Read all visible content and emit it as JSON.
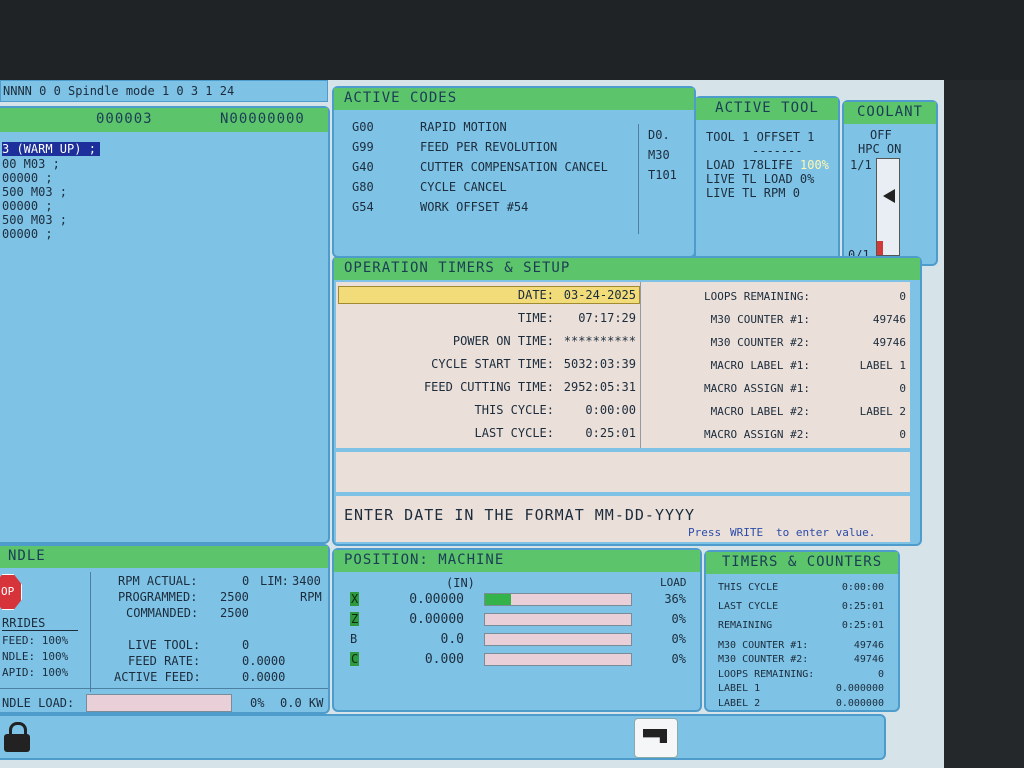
{
  "topbar": {
    "text": "NNNN   0   0 Spindle mode 1 0  3  1  24"
  },
  "program": {
    "header_left": "000003",
    "header_right": "N00000000",
    "lines": [
      "3 (WARM UP) ;",
      "00 M03 ;",
      "00000 ;",
      "500 M03 ;",
      "00000 ;",
      "500 M03 ;",
      "00000 ;"
    ]
  },
  "active_codes": {
    "title": "ACTIVE CODES",
    "codes": [
      {
        "code": "G00",
        "desc": "RAPID MOTION"
      },
      {
        "code": "G99",
        "desc": "FEED PER REVOLUTION"
      },
      {
        "code": "G40",
        "desc": "CUTTER COMPENSATION CANCEL"
      },
      {
        "code": "G80",
        "desc": "CYCLE CANCEL"
      },
      {
        "code": "G54",
        "desc": "WORK OFFSET  #54"
      }
    ],
    "right_codes": [
      "D0.",
      "M30",
      "T101"
    ]
  },
  "active_tool": {
    "title": "ACTIVE TOOL",
    "tool_line": "TOOL 1   OFFSET 1",
    "dash": "-------",
    "load": "LOAD 178LIFE",
    "life_pct": "100%",
    "live_load": "LIVE TL LOAD    0%",
    "live_rpm": "LIVE TL RPM     0"
  },
  "coolant": {
    "title": "COOLANT",
    "off": "OFF",
    "hpc": "HPC ON",
    "top": "1/1",
    "bottom": "0/1",
    "level": 0.15
  },
  "op_timers": {
    "title": "OPERATION TIMERS & SETUP",
    "left": [
      {
        "label": "DATE:",
        "value": "03-24-2025"
      },
      {
        "label": "TIME:",
        "value": "07:17:29"
      },
      {
        "label": "POWER ON TIME:",
        "value": "**********"
      },
      {
        "label": "CYCLE START TIME:",
        "value": "5032:03:39"
      },
      {
        "label": "FEED CUTTING TIME:",
        "value": "2952:05:31"
      },
      {
        "label": "THIS CYCLE:",
        "value": "0:00:00"
      },
      {
        "label": "LAST CYCLE:",
        "value": "0:25:01"
      }
    ],
    "right": [
      {
        "label": "LOOPS REMAINING:",
        "value": "0"
      },
      {
        "label": "M30 COUNTER #1:",
        "value": "49746"
      },
      {
        "label": "M30 COUNTER #2:",
        "value": "49746"
      },
      {
        "label": "MACRO LABEL #1:",
        "value": "LABEL 1"
      },
      {
        "label": "MACRO ASSIGN #1:",
        "value": "0"
      },
      {
        "label": "MACRO LABEL #2:",
        "value": "LABEL 2"
      },
      {
        "label": "MACRO ASSIGN #2:",
        "value": "0"
      }
    ],
    "prompt": "ENTER DATE IN THE FORMAT MM-DD-YYYY",
    "hint_press": "Press",
    "hint_write": "WRITE",
    "hint_rest": "to enter value."
  },
  "spindle": {
    "title": "NDLE",
    "stop": "OP",
    "overrides_title": "RRIDES",
    "overrides": [
      "FEED: 100%",
      "NDLE: 100%",
      "APID: 100%"
    ],
    "rpm_actual_label": "RPM ACTUAL:",
    "rpm_actual": "0",
    "lim_label": "LIM:",
    "lim": "3400",
    "programmed_label": "PROGRAMMED:",
    "programmed": "2500",
    "rpm_unit": "RPM",
    "commanded_label": "COMMANDED:",
    "commanded": "2500",
    "live_tool_label": "LIVE TOOL:",
    "live_tool": "0",
    "feed_rate_label": "FEED RATE:",
    "feed_rate": "0.0000",
    "active_feed_label": "ACTIVE FEED:",
    "active_feed": "0.0000",
    "load_label": "NDLE LOAD:",
    "load_pct": "0%",
    "load_kw": "0.0 KW"
  },
  "position": {
    "title": "POSITION: MACHINE",
    "unit": "(IN)",
    "load_header": "LOAD",
    "axes": [
      {
        "axis": "X",
        "value": "0.00000",
        "load": "36%",
        "fill": 0.18
      },
      {
        "axis": "Z",
        "value": "0.00000",
        "load": "0%",
        "fill": 0
      },
      {
        "axis": "B",
        "value": "0.0",
        "load": "0%",
        "fill": 0
      },
      {
        "axis": "C",
        "value": "0.000",
        "load": "0%",
        "fill": 0
      }
    ]
  },
  "timers_counters": {
    "title": "TIMERS & COUNTERS",
    "rows": [
      {
        "label": "THIS CYCLE",
        "value": "0:00:00"
      },
      {
        "label": "LAST CYCLE",
        "value": "0:25:01"
      },
      {
        "label": "REMAINING",
        "value": "0:25:01"
      },
      {
        "label": "M30 COUNTER #1:",
        "value": "49746"
      },
      {
        "label": "M30 COUNTER #2:",
        "value": "49746"
      },
      {
        "label": "LOOPS REMAINING:",
        "value": "0"
      },
      {
        "label": "LABEL 1",
        "value": "0.000000"
      },
      {
        "label": "LABEL 2",
        "value": "0.000000"
      }
    ]
  }
}
